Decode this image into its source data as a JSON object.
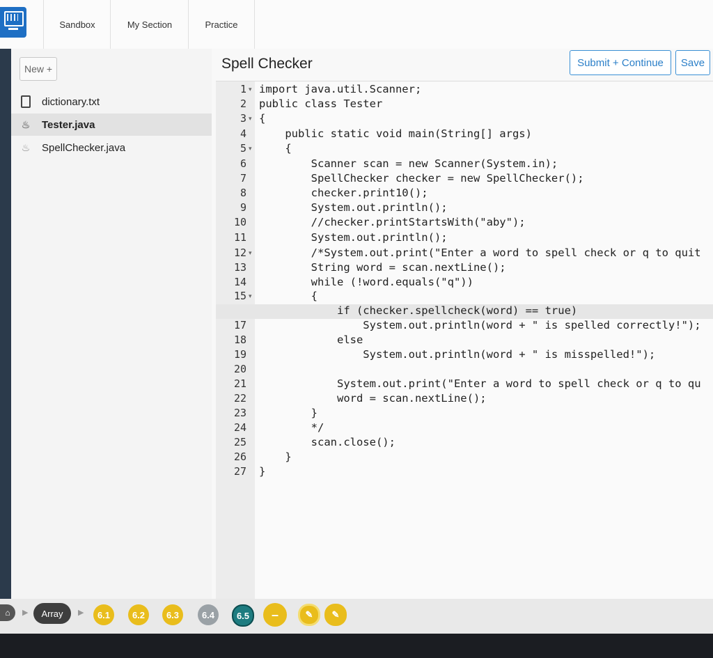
{
  "nav": {
    "sandbox": "Sandbox",
    "my_section": "My Section",
    "practice": "Practice"
  },
  "sidebar": {
    "new_label": "New +",
    "files": [
      {
        "name": "dictionary.txt",
        "icon": "document-icon"
      },
      {
        "name": "Tester.java",
        "icon": "java-icon",
        "active": true
      },
      {
        "name": "SpellChecker.java",
        "icon": "java-icon"
      }
    ]
  },
  "main": {
    "title": "Spell Checker",
    "submit_label": "Submit + Continue",
    "save_label": "Save"
  },
  "editor": {
    "active_line": 16,
    "lines": [
      "import java.util.Scanner;",
      "public class Tester",
      "{",
      "    public static void main(String[] args)",
      "    {",
      "        Scanner scan = new Scanner(System.in);",
      "        SpellChecker checker = new SpellChecker();",
      "        checker.print10();",
      "        System.out.println();",
      "        //checker.printStartsWith(\"aby\");",
      "        System.out.println();",
      "        /*System.out.print(\"Enter a word to spell check or q to quit",
      "        String word = scan.nextLine();",
      "        while (!word.equals(\"q\"))",
      "        {",
      "            if (checker.spellcheck(word) == true)",
      "                System.out.println(word + \" is spelled correctly!\");",
      "            else",
      "                System.out.println(word + \" is misspelled!\");",
      "",
      "            System.out.print(\"Enter a word to spell check or q to qu",
      "            word = scan.nextLine();",
      "        }",
      "        */",
      "        scan.close();",
      "    }",
      "}"
    ]
  },
  "bottombar": {
    "array_label": "Array",
    "crumbs": [
      "6.1",
      "6.2",
      "6.3",
      "6.4",
      "6.5",
      "–"
    ],
    "colors": {
      "yellow": "#e9bd1c",
      "grey": "#9aa1a6",
      "teal": "#1e7c80"
    }
  }
}
